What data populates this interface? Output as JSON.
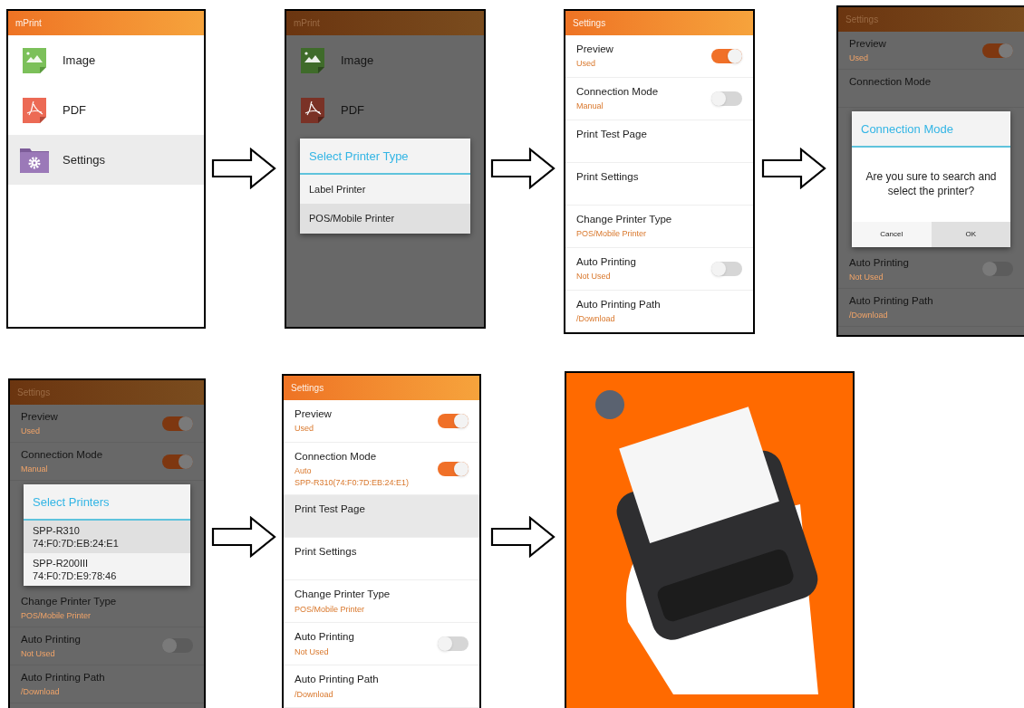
{
  "screens": [
    {
      "kind": "menu",
      "dimmed": false,
      "title": "mPrint",
      "rows": [
        {
          "kind": "entry",
          "label": "Image",
          "selected": false
        },
        {
          "kind": "entry",
          "label": "PDF",
          "selected": false
        },
        {
          "kind": "entry",
          "label": "Settings",
          "selected": true
        }
      ]
    },
    {
      "kind": "menu",
      "dimmed": true,
      "title": "mPrint",
      "rows": [
        {
          "kind": "entry",
          "label": "Image"
        },
        {
          "kind": "entry",
          "label": "PDF"
        },
        {
          "kind": "choice_dialog",
          "title": "Select Printer Type",
          "options": [
            {
              "label": "Label Printer",
              "selected": false
            },
            {
              "label": "POS/Mobile Printer",
              "selected": true
            }
          ]
        }
      ]
    },
    {
      "kind": "settings",
      "dimmed": false,
      "title": "Settings",
      "rows": [
        {
          "kind": "row",
          "label": "Preview",
          "value": "Used",
          "on": true,
          "selected": false
        },
        {
          "kind": "row",
          "label": "Connection Mode",
          "value": "Manual",
          "on": false,
          "selected": false
        },
        {
          "kind": "row",
          "label": "Print Test Page",
          "selected": false
        },
        {
          "kind": "row",
          "label": "Print Settings",
          "selected": false
        },
        {
          "kind": "row",
          "label": "Change Printer Type",
          "value": "POS/Mobile Printer",
          "selected": false
        },
        {
          "kind": "row",
          "label": "Auto Printing",
          "value": "Not Used",
          "on": false,
          "selected": false
        },
        {
          "kind": "row",
          "label": "Auto Printing Path",
          "value": "/Download",
          "selected": false
        }
      ]
    },
    {
      "kind": "settings",
      "dimmed": true,
      "title": "Settings",
      "rows": [
        {
          "kind": "row",
          "label": "Preview",
          "value": "Used",
          "on": true
        },
        {
          "kind": "row",
          "label": "Connection Mode"
        },
        {
          "kind": "confirm_dialog",
          "title": "Connection Mode",
          "message": "Are you sure to search and select the printer?",
          "buttons": [
            {
              "label": "Cancel",
              "selected": false
            },
            {
              "label": "OK",
              "selected": true
            }
          ]
        },
        {
          "kind": "row",
          "label": "Auto Printing",
          "value": "Not Used",
          "on": false
        },
        {
          "kind": "row",
          "label": "Auto Printing Path",
          "value": "/Download"
        }
      ]
    },
    {
      "kind": "settings",
      "dimmed": true,
      "title": "Settings",
      "rows": [
        {
          "kind": "row",
          "label": "Preview",
          "value": "Used",
          "on": true
        },
        {
          "kind": "row",
          "label": "Connection Mode",
          "value": "Manual",
          "on": true
        },
        {
          "kind": "choice_dialog",
          "title": "Select Printers",
          "options": [
            {
              "label": "SPP-R310",
              "detail": "74:F0:7D:EB:24:E1",
              "selected": true
            },
            {
              "label": "SPP-R200III",
              "detail": "74:F0:7D:E9:78:46",
              "selected": false
            }
          ]
        },
        {
          "kind": "row",
          "label": "Change Printer Type",
          "value": "POS/Mobile Printer"
        },
        {
          "kind": "row",
          "label": "Auto Printing",
          "value": "Not Used",
          "on": false
        },
        {
          "kind": "row",
          "label": "Auto Printing Path",
          "value": "/Download"
        }
      ]
    },
    {
      "kind": "settings",
      "dimmed": false,
      "title": "Settings",
      "rows": [
        {
          "kind": "row",
          "label": "Preview",
          "value": "Used",
          "on": true,
          "selected": false
        },
        {
          "kind": "row",
          "label": "Connection Mode",
          "value": "Auto",
          "detail": "SPP-R310(74:F0:7D:EB:24:E1)",
          "on": true,
          "selected": false
        },
        {
          "kind": "row",
          "label": "Print Test Page",
          "selected": true
        },
        {
          "kind": "row",
          "label": "Print Settings",
          "selected": false
        },
        {
          "kind": "row",
          "label": "Change Printer Type",
          "value": "POS/Mobile Printer",
          "selected": false
        },
        {
          "kind": "row",
          "label": "Auto Printing",
          "value": "Not Used",
          "on": false,
          "selected": false
        },
        {
          "kind": "row",
          "label": "Auto Printing Path",
          "value": "/Download",
          "selected": false
        }
      ]
    },
    {
      "kind": "photo"
    }
  ]
}
